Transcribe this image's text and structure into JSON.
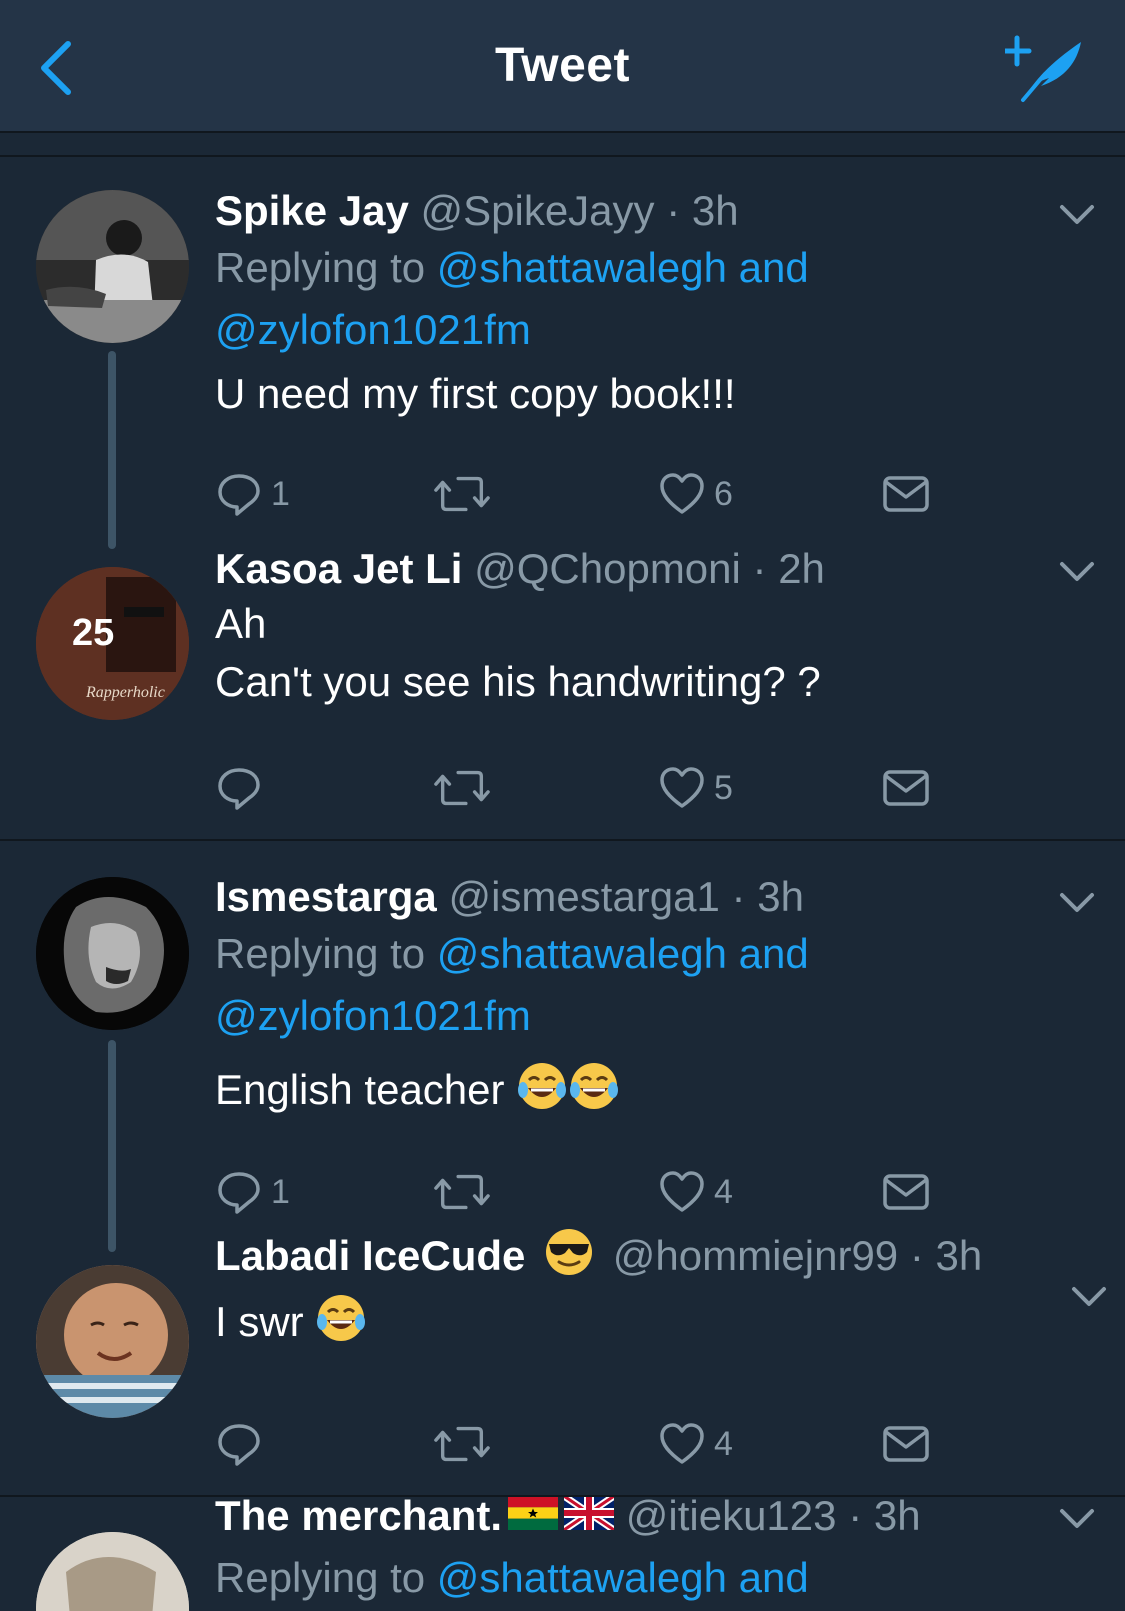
{
  "header": {
    "title": "Tweet"
  },
  "colors": {
    "accent": "#1da1f2",
    "bg": "#1b2836",
    "header_bg": "#243447",
    "muted": "#8899a6"
  },
  "tweets": [
    {
      "name": "Spike Jay",
      "handle": "@SpikeJayy",
      "dot": "·",
      "time": "3h",
      "replying_prefix": "Replying to ",
      "mention1": "@shattawalegh and",
      "mention2": "@zylofon1021fm",
      "text": "U need my first copy book!!!",
      "reply_count": "1",
      "like_count": "6"
    },
    {
      "name": "Kasoa Jet Li",
      "handle": "@QChopmoni",
      "dot": "·",
      "time": "2h",
      "text": "Ah\nCan't you see his handwriting? ?",
      "reply_count": "",
      "like_count": "5"
    },
    {
      "name": "Ismestarga",
      "handle": "@ismestarga1",
      "dot": "·",
      "time": "3h",
      "replying_prefix": "Replying to ",
      "mention1": "@shattawalegh and",
      "mention2": "@zylofon1021fm",
      "text": "English teacher",
      "reply_count": "1",
      "like_count": "4"
    },
    {
      "name": "Labadi IceCude",
      "handle": "@hommiejnr99",
      "dot": "·",
      "time": "3h",
      "text": "I swr",
      "reply_count": "",
      "like_count": "4"
    },
    {
      "name": "The merchant.",
      "handle": "@itieku123",
      "dot": "·",
      "time": "3h",
      "replying_prefix": "Replying to ",
      "mention1": "@shattawalegh and"
    }
  ]
}
